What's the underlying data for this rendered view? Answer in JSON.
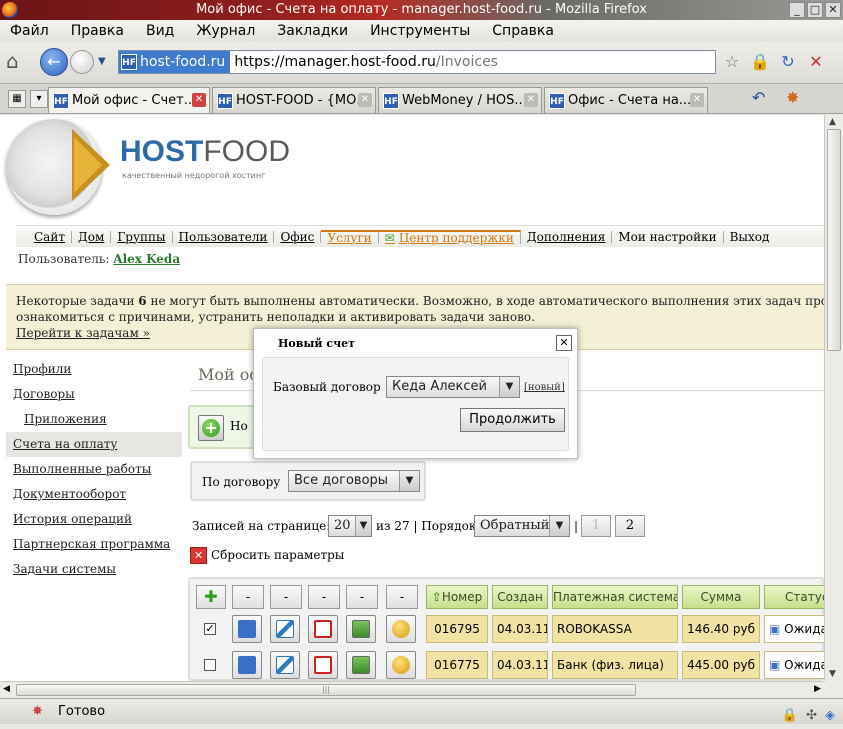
{
  "window": {
    "title": "Мой офис - Счета на оплату - manager.host-food.ru - Mozilla Firefox",
    "buttons": [
      "_",
      "□",
      "✕"
    ]
  },
  "menu": [
    "Файл",
    "Правка",
    "Вид",
    "Журнал",
    "Закладки",
    "Инструменты",
    "Справка"
  ],
  "address": {
    "site": "host-food.ru",
    "favicon": "HF",
    "prefix": "https://manager.",
    "domain": "host-food.ru",
    "path": "/Invoices"
  },
  "tabs": [
    {
      "label": "Мой офис - Счет...",
      "active": true
    },
    {
      "label": "HOST-FOOD - {МО..."
    },
    {
      "label": "WebMoney / HOS..."
    },
    {
      "label": "Офис - Счета на..."
    }
  ],
  "brand": {
    "host": "HOST",
    "food": "FOOD",
    "slogan": "качественный недорогой хостинг"
  },
  "topnav": [
    "Сайт",
    "Дом",
    "Группы",
    "Пользователи",
    "Офис",
    "Услуги",
    "Центр поддержки",
    "Дополнения",
    "Мои настройки",
    "Выход"
  ],
  "user": {
    "label": "Пользователь:",
    "name": "Alex Keda"
  },
  "notice": {
    "line1_a": "Некоторые задачи ",
    "count": "6",
    "line1_b": " не могут быть выполнены автоматически. Возможно, в ходе автоматического выполнения этих задач произошли",
    "line2": "ознакомиться с причинами, устранить неполадки и активировать задачи заново.",
    "link": "Перейти к задачам »"
  },
  "sidebar": [
    "Профили",
    "Договоры",
    "Приложения",
    "Счета на оплату",
    "Выполненные работы",
    "Документооборот",
    "История операций",
    "Партнерская программа",
    "Задачи системы"
  ],
  "page": {
    "title": "Мой офис",
    "new_label": "Но"
  },
  "filter": {
    "label": "По договору",
    "value": "Все договоры"
  },
  "pager": {
    "per_page_label": "Записей на странице:",
    "per_page": "20",
    "of_label": "из 27 | Порядок:",
    "order": "Обратный",
    "sep": "|",
    "pages": [
      "1",
      "2"
    ]
  },
  "reset": {
    "label": "Сбросить параметры"
  },
  "table": {
    "dash": "-",
    "headers": [
      "Номер",
      "Создан",
      "Платежная система",
      "Сумма",
      "Статус"
    ],
    "rows": [
      {
        "checked": true,
        "check_mark": "✓",
        "number": "016795",
        "created": "04.03.11",
        "system": "ROBOKASSA",
        "sum": "146.40 руб",
        "status": "Ожидает"
      },
      {
        "checked": false,
        "check_mark": "",
        "number": "016775",
        "created": "04.03.11",
        "system": "Банк (физ. лица)",
        "sum": "445.00 руб",
        "status": "Ожидает"
      }
    ]
  },
  "modal": {
    "title": "Новый счет",
    "close": "✕",
    "label": "Базовый договор",
    "select_value": "Кеда Алексей",
    "new_link": "[новый]",
    "button": "Продолжить"
  },
  "status": {
    "text": "Готово"
  }
}
